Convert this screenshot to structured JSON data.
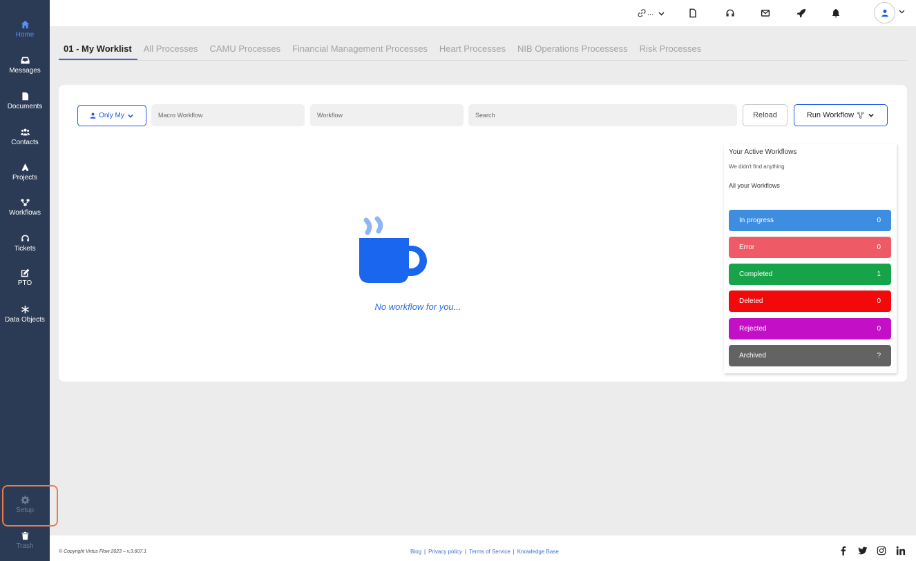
{
  "sidebar": {
    "items": [
      {
        "label": "Home",
        "icon": "home-icon"
      },
      {
        "label": "Messages",
        "icon": "inbox-icon"
      },
      {
        "label": "Documents",
        "icon": "file-icon"
      },
      {
        "label": "Contacts",
        "icon": "users-icon"
      },
      {
        "label": "Projects",
        "icon": "pen-nib-icon"
      },
      {
        "label": "Workflows",
        "icon": "sitemap-icon"
      },
      {
        "label": "Tickets",
        "icon": "headset-icon"
      },
      {
        "label": "PTO",
        "icon": "edit-icon"
      },
      {
        "label": "Data Objects",
        "icon": "asterisk-icon"
      }
    ],
    "setup_label": "Setup",
    "trash_label": "Trash",
    "colors": {
      "background": "#2b3a55",
      "active": "#5b8dff"
    }
  },
  "topbar": {
    "link_text": "...",
    "icons": [
      "link-icon",
      "document-icon",
      "headset-icon",
      "mail-icon",
      "rocket-icon",
      "bell-icon",
      "avatar"
    ]
  },
  "tabs": [
    {
      "label": "01 - My Worklist",
      "active": true
    },
    {
      "label": "All Processes"
    },
    {
      "label": "CAMU Processes"
    },
    {
      "label": "Financial Management Processes"
    },
    {
      "label": "Heart Processes"
    },
    {
      "label": "NIB Operations Processess"
    },
    {
      "label": "Risk Processes"
    }
  ],
  "filters": {
    "only_my_label": "Only My",
    "macro_workflow_placeholder": "Macro Workflow",
    "workflow_placeholder": "Workflow",
    "search_placeholder": "Search",
    "reload_label": "Reload",
    "run_workflow_label": "Run Workflow"
  },
  "empty_state": {
    "text": "No workflow for you...",
    "icon": "coffee-cup-icon"
  },
  "workflow_panel": {
    "active_title": "Your Active Workflows",
    "not_found": "We didn't find anything",
    "all_title": "All your Workflows",
    "statuses": [
      {
        "label": "In progress",
        "count": "0",
        "color": "#3d8ee0"
      },
      {
        "label": "Error",
        "count": "0",
        "color": "#ee5a66"
      },
      {
        "label": "Completed",
        "count": "1",
        "color": "#17a349"
      },
      {
        "label": "Deleted",
        "count": "0",
        "color": "#f20a0a"
      },
      {
        "label": "Rejected",
        "count": "0",
        "color": "#c30fc6"
      },
      {
        "label": "Archived",
        "count": "?",
        "color": "#636363"
      }
    ]
  },
  "footer": {
    "copyright": "© Copyright Virtus Flow 2023 – v.3.607.1",
    "links": [
      "Blog",
      "Privacy policy",
      "Terms of Service",
      "Knowledge Base"
    ],
    "social": [
      "facebook-icon",
      "twitter-icon",
      "instagram-icon",
      "linkedin-icon"
    ]
  }
}
